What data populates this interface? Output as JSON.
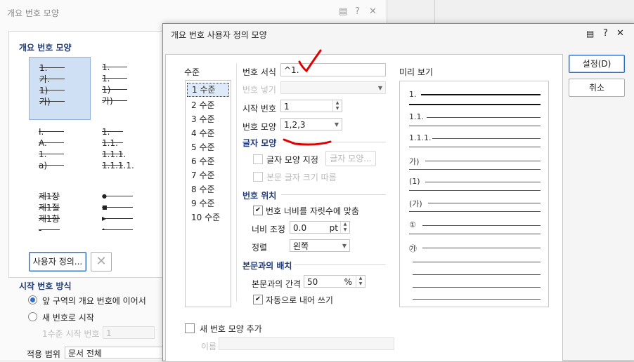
{
  "background_dialog": {
    "title": "개요 번호 모양",
    "section_shape": "개요 번호 모양",
    "tiles": [
      {
        "rows": [
          "1.",
          "가.",
          "1)",
          "가)"
        ]
      },
      {
        "rows": [
          "1.",
          "1.",
          "1)",
          "가)"
        ]
      },
      {
        "rows": [
          "I.",
          "A.",
          "1.",
          "a)"
        ]
      },
      {
        "rows": [
          "1.",
          "1.1.",
          "1.1.1.",
          "1.1.1.1."
        ]
      },
      {
        "rows": [
          "제1장",
          "제1절",
          "제1항",
          "-"
        ]
      },
      {
        "rows": [
          "●",
          "■",
          "▶",
          "•"
        ]
      }
    ],
    "custom_button": "사용자 정의...",
    "start_section": "시작 번호 방식",
    "radio_continue": "앞 구역의 개요 번호에 이어서",
    "radio_new": "새 번호로 시작",
    "level1_start_label": "1수준 시작 번호",
    "level1_start_value": "1",
    "apply_label": "적용 범위",
    "apply_value": "문서 전체"
  },
  "dialog": {
    "title": "개요 번호 사용자 정의 모양",
    "levels_label": "수준",
    "levels": [
      "1 수준",
      "2 수준",
      "3 수준",
      "4 수준",
      "5 수준",
      "6 수준",
      "7 수준",
      "8 수준",
      "9 수준",
      "10 수준"
    ],
    "selected_level": "1 수준",
    "number_format_label": "번호 서식",
    "number_format_value": "^1.",
    "number_insert_label": "번호 넣기",
    "start_number_label": "시작 번호",
    "start_number_value": "1",
    "number_shape_label": "번호 모양",
    "number_shape_value": "1,2,3",
    "char_shape_group": "글자 모양",
    "char_shape_specify": "글자 모양 지정",
    "char_shape_button": "글자 모양...",
    "follow_body_size": "본문 글자 크기 따름",
    "number_position_group": "번호 위치",
    "fit_width": "번호 너비를 자릿수에 맞춤",
    "width_adjust_label": "너비 조정",
    "width_adjust_value": "0.0",
    "width_unit": "pt",
    "align_label": "정렬",
    "align_value": "왼쪽",
    "body_layout_group": "본문과의 배치",
    "body_gap_label": "본문과의 간격",
    "body_gap_value": "50",
    "body_gap_unit": "%",
    "auto_outdent": "자동으로 내어 쓰기",
    "preview_label": "미리 보기",
    "preview_rows": [
      "1.",
      "1.1.",
      "1.1.1.",
      "가)",
      "(1)",
      "(가)",
      "①",
      "㉮"
    ],
    "add_new_shape": "새 번호 모양 추가",
    "name_label": "이름",
    "ok_button": "설정(D)",
    "cancel_button": "취소"
  },
  "colors": {
    "accent": "#2d6fd0",
    "group_heading": "#1f3a78",
    "annotation": "#e00000"
  }
}
